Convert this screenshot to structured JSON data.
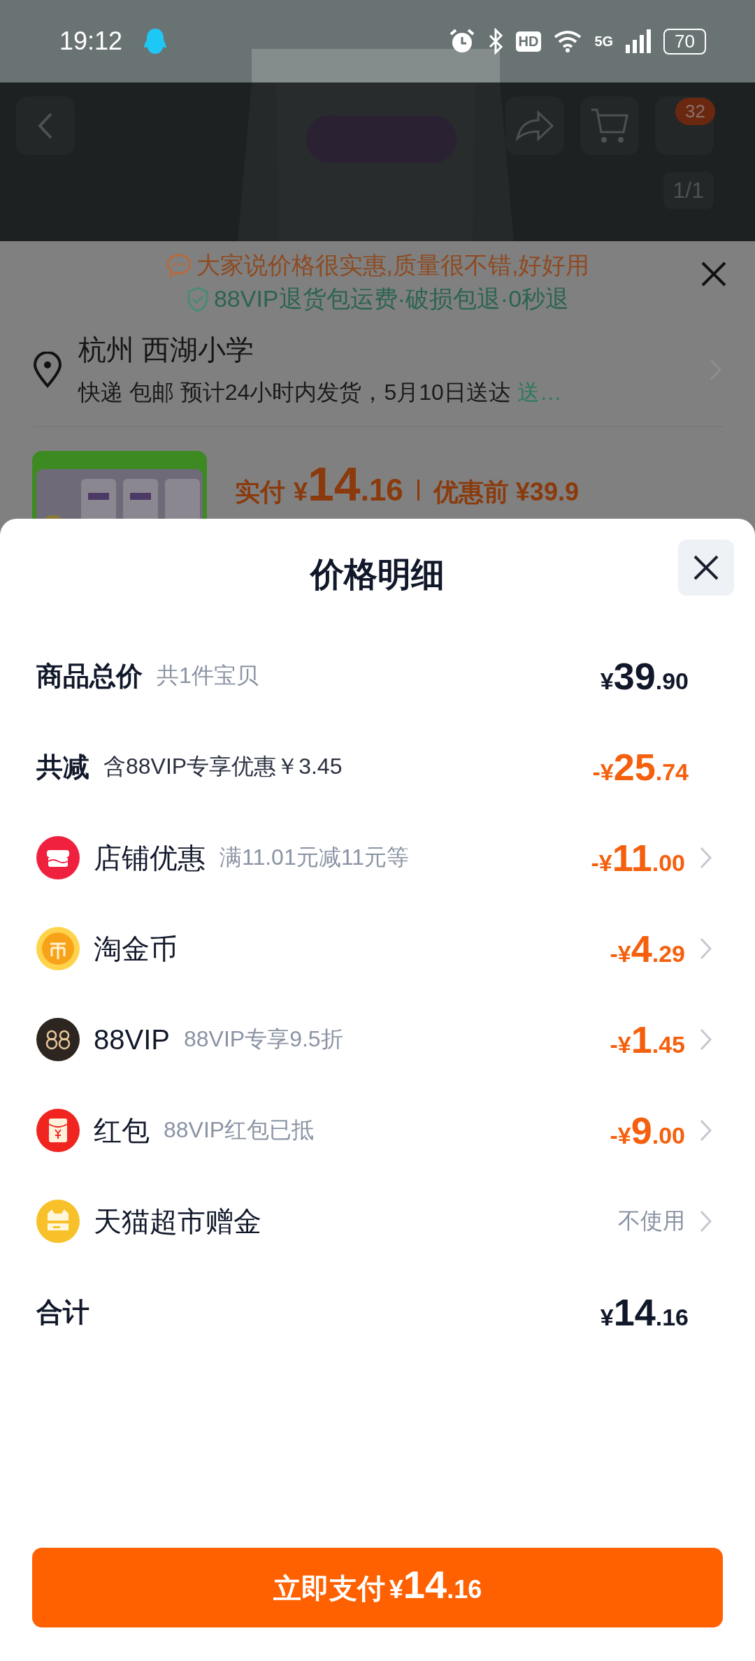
{
  "status_bar": {
    "time": "19:12",
    "hd": "HD",
    "network": "5G",
    "battery": "70"
  },
  "nav": {
    "badge": "32",
    "page_counter": "1/1"
  },
  "behind_panel": {
    "review": "大家说价格很实惠,质量很不错,好好用",
    "guarantee": "88VIP退货包运费·破损包退·0秒退",
    "location": "杭州 西湖小学",
    "delivery": "快递 包邮 预计24小时内发货，5月10日送达 ",
    "delivery_tail": "送…",
    "paid_label": "实付",
    "paid": {
      "sign": "¥",
      "whole": "14",
      "cents": ".16"
    },
    "original_label": "优惠前 ¥39.9"
  },
  "sheet": {
    "title": "价格明细",
    "rows": [
      {
        "kind": "summary",
        "label": "商品总价",
        "note": "共1件宝贝",
        "amount": {
          "sign": "¥",
          "whole": "39",
          "cents": ".90",
          "highlight": false
        }
      },
      {
        "kind": "summary",
        "label": "共减",
        "note": "含88VIP专享优惠￥3.45",
        "amount": {
          "sign": "-¥",
          "whole": "25",
          "cents": ".74",
          "highlight": true
        }
      },
      {
        "kind": "store",
        "label": "店铺优惠",
        "note": "满11.01元减11元等",
        "amount": {
          "sign": "-¥",
          "whole": "11",
          "cents": ".00",
          "highlight": true
        }
      },
      {
        "kind": "coin",
        "label": "淘金币",
        "amount": {
          "sign": "-¥",
          "whole": "4",
          "cents": ".29",
          "highlight": true
        }
      },
      {
        "kind": "vip",
        "label": "88VIP",
        "note": "88VIP专享9.5折",
        "amount": {
          "sign": "-¥",
          "whole": "1",
          "cents": ".45",
          "highlight": true
        }
      },
      {
        "kind": "redpacket",
        "label": "红包",
        "note": "88VIP红包已抵",
        "amount": {
          "sign": "-¥",
          "whole": "9",
          "cents": ".00",
          "highlight": true
        }
      },
      {
        "kind": "giftcard",
        "label": "天猫超市赠金",
        "value": "不使用"
      },
      {
        "kind": "summary",
        "label": "合计",
        "amount": {
          "sign": "¥",
          "whole": "14",
          "cents": ".16",
          "highlight": false
        }
      }
    ]
  },
  "pay_button": {
    "label": "立即支付",
    "amount": {
      "sign": "¥",
      "whole": "14",
      "cents": ".16"
    }
  }
}
